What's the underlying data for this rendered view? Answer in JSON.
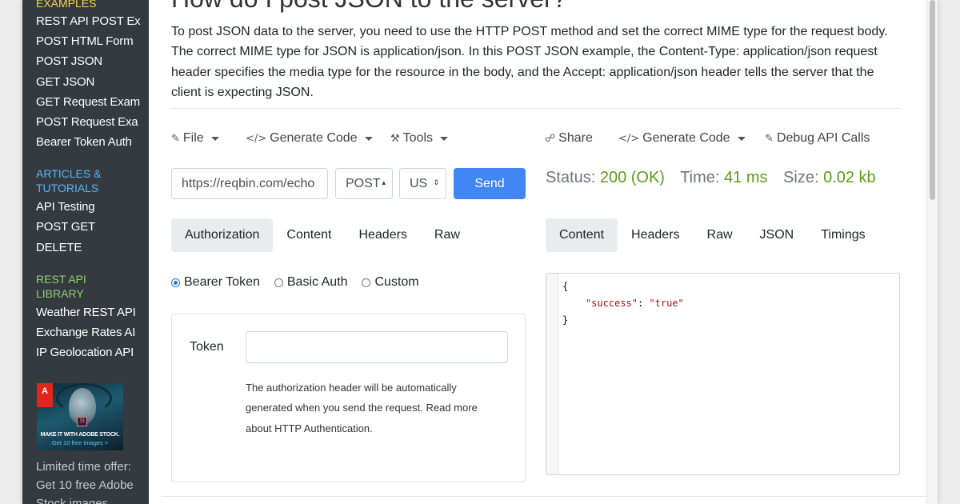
{
  "sidebar": {
    "section1_heading": "EXAMPLES",
    "section1_items": [
      "REST API POST Ex",
      "POST HTML Form",
      "POST JSON",
      "GET JSON",
      "GET Request Exam",
      "POST Request Exa",
      "Bearer Token Auth"
    ],
    "section2_heading_line1": "ARTICLES &",
    "section2_heading_line2": "TUTORIALS",
    "section2_items": [
      "API Testing",
      "POST GET",
      "DELETE"
    ],
    "section3_heading_line1": "REST API",
    "section3_heading_line2": "LIBRARY",
    "section3_items": [
      "Weather REST API",
      "Exchange Rates AI",
      "IP Geolocation API"
    ],
    "ad": {
      "logo_text": "A",
      "badge_text": "St",
      "line1": "MAKE IT WITH ADOBE STOCK.",
      "line2": "Get 10 free images >"
    },
    "promo_lines": [
      "Limited time offer:",
      "Get 10 free Adobe",
      "Stock images."
    ],
    "colors": {
      "background": "#343a40",
      "heading1": "#f7d34a",
      "heading2": "#5ab4f5",
      "heading3": "#8ed16b"
    }
  },
  "main": {
    "title": "How do I post JSON to the server?",
    "intro": "To post JSON data to the server, you need to use the HTTP POST method and set the correct MIME type for the request body. The correct MIME type for JSON is application/json. In this POST JSON example, the Content-Type: application/json request header specifies the media type for the resource in the body, and the Accept: application/json header tells the server that the client is expecting JSON.",
    "left_toolbar": [
      {
        "icon": "edit-icon",
        "label": "File"
      },
      {
        "icon": "code-icon",
        "label": "Generate Code"
      },
      {
        "icon": "wrench-icon",
        "label": "Tools"
      }
    ],
    "right_toolbar": [
      {
        "icon": "share-icon",
        "label": "Share"
      },
      {
        "icon": "code-icon",
        "label": "Generate Code"
      },
      {
        "icon": "debug-icon",
        "label": "Debug API Calls"
      }
    ],
    "request": {
      "url": "https://reqbin.com/echo",
      "method": "POST",
      "region": "US",
      "send_label": "Send"
    },
    "response_status": {
      "status_label": "Status:",
      "status_value": "200 (OK)",
      "time_label": "Time:",
      "time_value": "41 ms",
      "size_label": "Size:",
      "size_value": "0.02 kb"
    },
    "request_tabs": [
      "Authorization",
      "Content",
      "Headers",
      "Raw"
    ],
    "response_tabs": [
      "Content",
      "Headers",
      "Raw",
      "JSON",
      "Timings"
    ],
    "auth_options": [
      "Bearer Token",
      "Basic Auth",
      "Custom"
    ],
    "token_label": "Token",
    "token_value": "",
    "token_help": "The authorization header will be automatically generated when you send the request. Read more about HTTP Authentication.",
    "response_body": {
      "open": "{",
      "key": "\"success\"",
      "sep": ": ",
      "value": "\"true\"",
      "close": "}"
    },
    "colors": {
      "accent": "#4285f4",
      "success": "#5b9c1b",
      "tab_active_bg": "#e9ecef"
    }
  }
}
